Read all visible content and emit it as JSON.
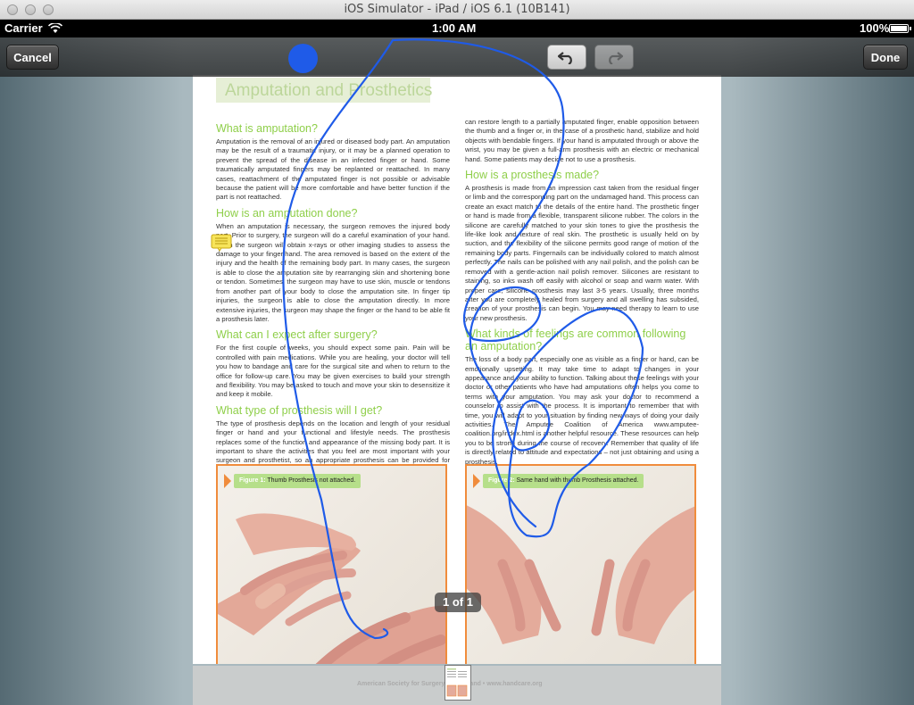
{
  "window": {
    "title": "iOS Simulator - iPad / iOS 6.1 (10B141)"
  },
  "status_bar": {
    "carrier": "Carrier",
    "time": "1:00 AM",
    "battery": "100%"
  },
  "toolbar": {
    "cancel_label": "Cancel",
    "done_label": "Done",
    "undo_icon": "undo-icon",
    "redo_icon": "redo-icon",
    "ink_color": "#1f5be8"
  },
  "document": {
    "header_title": "Amputation and Prosthetics",
    "left_column": [
      {
        "heading": "What is amputation?",
        "body": "Amputation is the removal of an injured or diseased body part. An amputation may be the result of a traumatic injury, or it may be a planned operation to prevent the spread of the disease in an infected finger or hand. Some traumatically amputated fingers may be replanted or reattached. In many cases, reattachment of the amputated finger is not possible or advisable because the patient will be more comfortable and have better function if the part is not reattached."
      },
      {
        "heading": "How is an amputation done?",
        "body": "When an amputation is necessary, the surgeon removes the injured body part. Prior to surgery, the surgeon will do a careful examination of your hand. Often the surgeon will obtain x-rays or other imaging studies to assess the damage to your finger/hand. The area removed is based on the extent of the injury and the health of the remaining body part. In many cases, the surgeon is able to close the amputation site by rearranging skin and shortening bone or tendon. Sometimes, the surgeon may have to use skin, muscle or tendons from another part of your body to close the amputation site. In finger tip injuries, the surgeon is able to close the amputation directly. In more extensive injuries, the surgeon may shape the finger or the hand to be able fit a prosthesis later."
      },
      {
        "heading": "What can I expect after surgery?",
        "body": "For the first couple of weeks, you should expect some pain. Pain will be controlled with pain medications. While you are healing, your doctor will tell you how to bandage and care for the surgical site and when to return to the office for follow-up care. You may be given exercises to build your strength and flexibility. You may be asked to touch and move your skin to desensitize it and keep it mobile."
      },
      {
        "heading": "What type of prosthesis will I get?",
        "body": "The type of prosthesis depends on the location and length of your residual finger or hand and your functional and lifestyle needs. The prosthesis replaces some of the function and appearance of the missing body part. It is important to share the activities that you feel are most important with your surgeon and prosthetist, so an appropriate prosthesis can be provided for you. Prostheses"
      }
    ],
    "right_column": [
      {
        "heading": "",
        "body": "can restore length to a partially amputated finger, enable opposition between the thumb and a finger or, in the case of a prosthetic hand, stabilize and hold objects with bendable fingers. If your hand is amputated through or above the wrist, you may be given a full-arm prosthesis with an electric or mechanical hand. Some patients may decide not to use a prosthesis."
      },
      {
        "heading": "How is a prosthesis made?",
        "body": "A prosthesis is made from an impression cast taken from the residual finger or limb and the corresponding part on the undamaged hand. This process can create an exact match to the details of the entire hand. The prosthetic finger or hand is made from a flexible, transparent silicone rubber. The colors in the silicone are carefully matched to your skin tones to give the prosthesis the life-like look and texture of real skin. The prosthetic is usually held on by suction, and the flexibility of the silicone permits good range of motion of the remaining body parts. Fingernails can be individually colored to match almost perfectly. The nails can be polished with any nail polish, and the polish can be removed with a gentle-action nail polish remover. Silicones are resistant to staining, so inks wash off easily with alcohol or soap and warm water. With proper care, silicone prosthesis may last 3-5 years. Usually, three months after you are completely healed from surgery and all swelling has subsided, creation of your prosthesis can begin. You may need therapy to learn to use your new prosthesis."
      },
      {
        "heading": "What kinds of feelings are common following an amputation?",
        "body": "The loss of a body part, especially one as visible as a finger or hand, can be emotionally upsetting. It may take time to adapt to changes in your appearance and your ability to function. Talking about these feelings with your doctor or other patients who have had amputations often helps you come to terms with your amputation. You may ask your doctor to recommend a counselor to assist with the process. It is important to remember that with time, you will adapt to your situation by finding new ways of doing your daily activities. The Amputee Coalition of America www.amputee-coalition.org/index.html is another helpful resource. These resources can help you to be strong during the course of recovery. Remember that quality of life is directly related to attitude and expectations – not just obtaining and using a prosthesis."
      }
    ],
    "figures": [
      {
        "label": "Figure 1:",
        "caption": "Thumb Prosthesis not attached."
      },
      {
        "label": "Figure 2:",
        "caption": "Same hand with thumb Prosthesis attached."
      }
    ],
    "footer_text": "American Society for Surgery of the Hand • www.handcare.org"
  },
  "page_indicator": "1 of 1",
  "note_icon": "sticky-note-icon"
}
